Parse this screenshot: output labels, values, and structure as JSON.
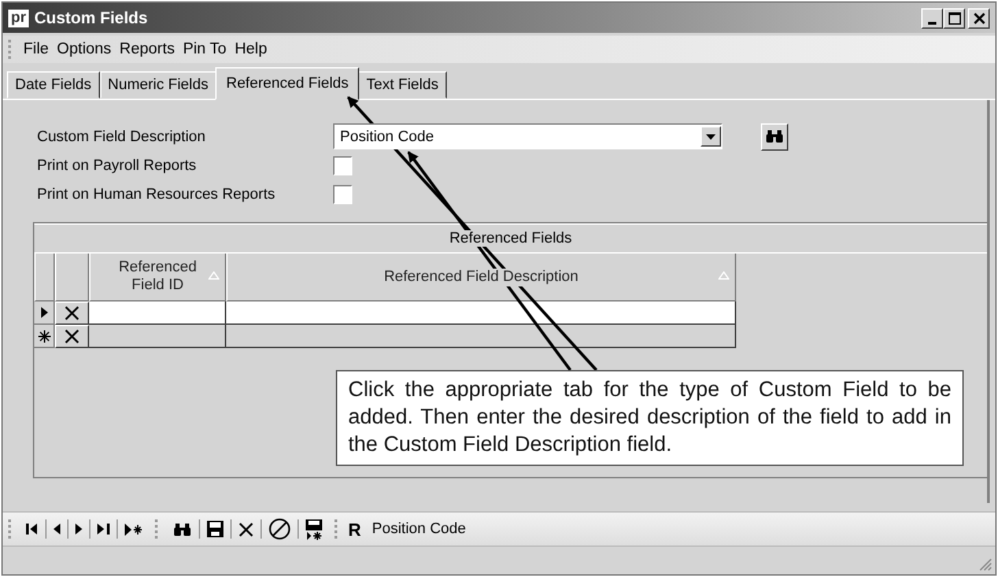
{
  "window": {
    "app_badge": "pr",
    "title": "Custom Fields"
  },
  "menu": [
    "File",
    "Options",
    "Reports",
    "Pin To",
    "Help"
  ],
  "tabs": [
    {
      "label": "Date Fields",
      "selected": false
    },
    {
      "label": "Numeric Fields",
      "selected": false
    },
    {
      "label": "Referenced Fields",
      "selected": true
    },
    {
      "label": "Text Fields",
      "selected": false
    }
  ],
  "form": {
    "description_label": "Custom Field Description",
    "description_value": "Position Code",
    "checkboxes": [
      {
        "label": "Print on Payroll Reports",
        "checked": false
      },
      {
        "label": "Print on Human Resources Reports",
        "checked": false
      }
    ]
  },
  "grid": {
    "title": "Referenced Fields",
    "columns": [
      "Referenced Field ID",
      "Referenced Field Description"
    ],
    "rows": [
      {
        "kind": "current"
      },
      {
        "kind": "new"
      }
    ]
  },
  "callout": "Click the appropriate tab for the type of Custom Field to be added.  Then enter the desired description of the field to add in the Custom Field Description field.",
  "toolbar": {
    "record_glyph": "R",
    "record_label": "Position Code"
  }
}
